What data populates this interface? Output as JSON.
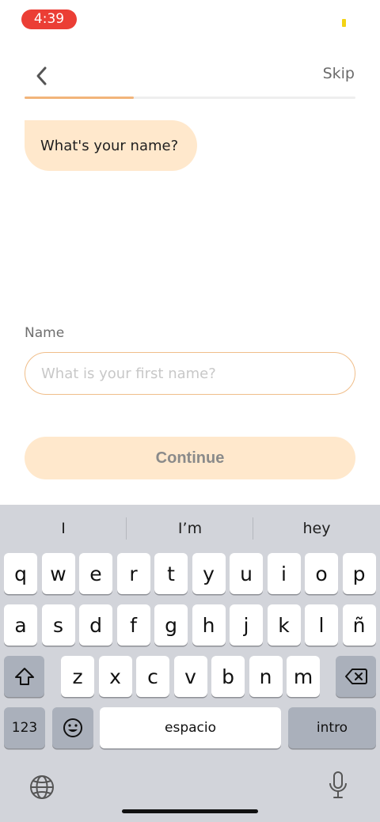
{
  "status_bar": {
    "time": "4:39",
    "colors": {
      "time_pill": "#EB3E35",
      "battery": "#F3D314"
    }
  },
  "header": {
    "back_icon": "chevron-left-icon",
    "skip_label": "Skip"
  },
  "progress": {
    "fraction": 0.33,
    "colors": {
      "fill": "#F2B47A",
      "track": "#EEEEEE"
    }
  },
  "chat": {
    "question": "What's your name?"
  },
  "form": {
    "label": "Name",
    "input_value": "",
    "input_placeholder": "What is your first name?",
    "continue_label": "Continue",
    "colors": {
      "accent": "#F0BE8A",
      "button_bg": "#FFE8CC"
    }
  },
  "keyboard": {
    "suggestions": [
      "I",
      "I’m",
      "hey"
    ],
    "row1": [
      "q",
      "w",
      "e",
      "r",
      "t",
      "y",
      "u",
      "i",
      "o",
      "p"
    ],
    "row2": [
      "a",
      "s",
      "d",
      "f",
      "g",
      "h",
      "j",
      "k",
      "l",
      "ñ"
    ],
    "row3": [
      "z",
      "x",
      "c",
      "v",
      "b",
      "n",
      "m"
    ],
    "numbers_label": "123",
    "space_label": "espacio",
    "return_label": "intro",
    "icons": {
      "shift": "shift-icon",
      "delete": "backspace-icon",
      "emoji": "emoji-icon",
      "globe": "globe-icon",
      "mic": "microphone-icon"
    }
  }
}
